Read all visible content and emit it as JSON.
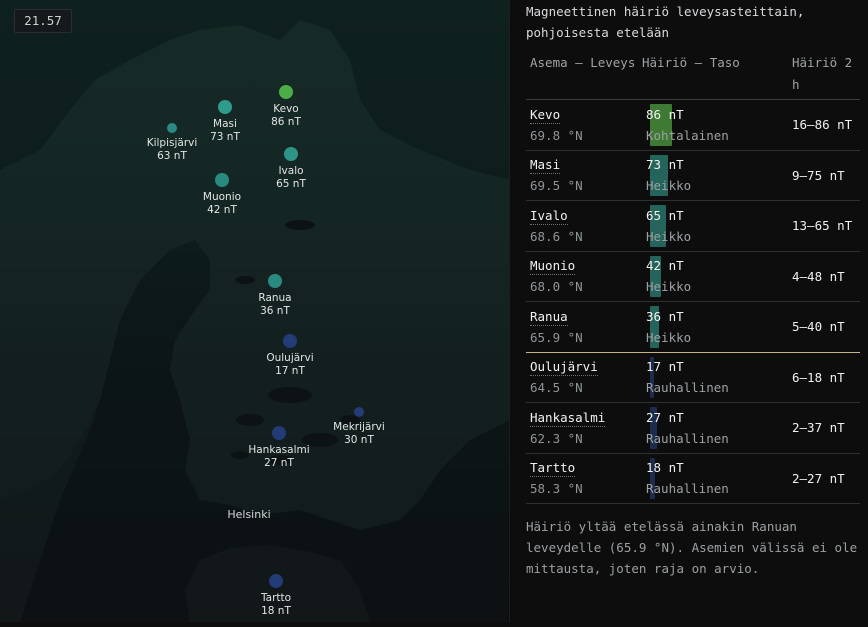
{
  "map": {
    "clock": "21.57",
    "stations": [
      {
        "name": "Kevo",
        "value": "86 nT",
        "color": "#4cad48"
      },
      {
        "name": "Masi",
        "value": "73 nT",
        "color": "#2f9b8a"
      },
      {
        "name": "Kilpisjärvi",
        "value": "63 nT",
        "color": "#2a8a80"
      },
      {
        "name": "Ivalo",
        "value": "65 nT",
        "color": "#2e9486"
      },
      {
        "name": "Muonio",
        "value": "42 nT",
        "color": "#2a8a80"
      },
      {
        "name": "Ranua",
        "value": "36 nT",
        "color": "#2a8a80"
      },
      {
        "name": "Oulujärvi",
        "value": "17 nT",
        "color": "#233c78"
      },
      {
        "name": "Mekrijärvi",
        "value": "30 nT",
        "color": "#233c78"
      },
      {
        "name": "Hankasalmi",
        "value": "27 nT",
        "color": "#233c78"
      },
      {
        "name": "Tartto",
        "value": "18 nT",
        "color": "#233c78"
      }
    ],
    "city": "Helsinki"
  },
  "panel": {
    "title": "Magneettinen häiriö leveysasteittain, pohjoisesta etelään",
    "headers": {
      "station": "Asema – Leveys",
      "magnitude": "Häiriö – Taso",
      "range": "Häiriö 2 h"
    },
    "rows": [
      {
        "name": "Kevo",
        "lat": "69.8 °N",
        "value": "86 nT",
        "level": "Kohtalainen",
        "range": "16–86 nT",
        "fraction": 0.86,
        "bar_color": "#3f7a34"
      },
      {
        "name": "Masi",
        "lat": "69.5 °N",
        "value": "73 nT",
        "level": "Heikko",
        "range": "9–75 nT",
        "fraction": 0.73,
        "bar_color": "#24645b"
      },
      {
        "name": "Ivalo",
        "lat": "68.6 °N",
        "value": "65 nT",
        "level": "Heikko",
        "range": "13–65 nT",
        "fraction": 0.65,
        "bar_color": "#24645b"
      },
      {
        "name": "Muonio",
        "lat": "68.0 °N",
        "value": "42 nT",
        "level": "Heikko",
        "range": "4–48 nT",
        "fraction": 0.42,
        "bar_color": "#24645b"
      },
      {
        "name": "Ranua",
        "lat": "65.9 °N",
        "value": "36 nT",
        "level": "Heikko",
        "range": "5–40 nT",
        "fraction": 0.36,
        "bar_color": "#24645b"
      },
      {
        "name": "Oulujärvi",
        "lat": "64.5 °N",
        "value": "17 nT",
        "level": "Rauhallinen",
        "range": "6–18 nT",
        "fraction": 0.17,
        "bar_color": "#1d2c4d"
      },
      {
        "name": "Hankasalmi",
        "lat": "62.3 °N",
        "value": "27 nT",
        "level": "Rauhallinen",
        "range": "2–37 nT",
        "fraction": 0.27,
        "bar_color": "#1d2c4d"
      },
      {
        "name": "Tartto",
        "lat": "58.3 °N",
        "value": "18 nT",
        "level": "Rauhallinen",
        "range": "2–27 nT",
        "fraction": 0.18,
        "bar_color": "#1d2c4d"
      }
    ],
    "footnote": "Häiriö yltää etelässä ainakin Ranuan leveydelle (65.9 °N). Asemien välissä ei ole mittausta, joten raja on arvio."
  }
}
